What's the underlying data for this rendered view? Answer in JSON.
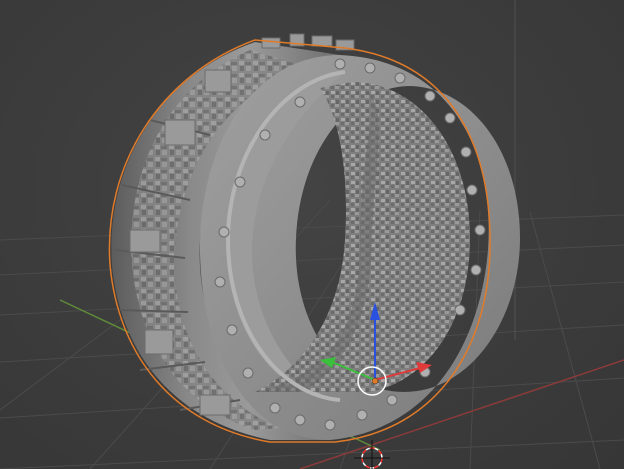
{
  "viewport": {
    "background_color": "#3d3d3d",
    "grid_color": "#4a4a4a",
    "x_axis_color": "#8b3a3a",
    "y_axis_color": "#5e8a3a",
    "z_axis_color": "#5a5a5a"
  },
  "selection": {
    "outline_color": "#e07b2a",
    "object": "ring-mesh"
  },
  "gizmo": {
    "x_arrow_color": "#e03a3a",
    "y_arrow_color": "#3ac03a",
    "z_arrow_color": "#2a50e0",
    "origin_color": "#e07b2a",
    "center_ring_color": "#ffffff"
  },
  "cursor_3d": {
    "ring_colors": [
      "#ff3030",
      "#ffffff"
    ],
    "icon": "crosshair-icon"
  }
}
